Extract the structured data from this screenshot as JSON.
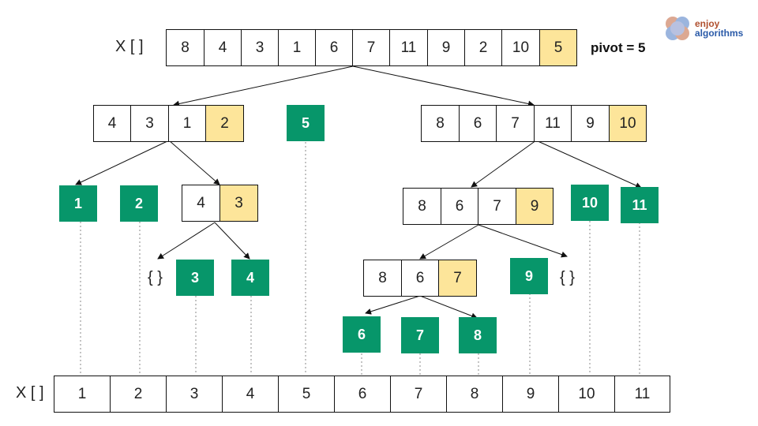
{
  "title_label": "X [ ]",
  "pivot_text": "pivot = 5",
  "logo": {
    "line1": "enjoy",
    "line2": "algorithms"
  },
  "colors": {
    "sorted": "#07966a",
    "pivot": "#fde59a",
    "cell": "#ffffff"
  },
  "input_array": [
    "8",
    "4",
    "3",
    "1",
    "6",
    "7",
    "11",
    "9",
    "2",
    "10",
    "5"
  ],
  "level1_left": [
    "4",
    "3",
    "1",
    "2"
  ],
  "level1_pivot": "5",
  "level1_right": [
    "8",
    "6",
    "7",
    "11",
    "9",
    "10"
  ],
  "level2_left_sorted": [
    "1",
    "2"
  ],
  "level2_mid": [
    "4",
    "3"
  ],
  "level2_right": [
    "8",
    "6",
    "7",
    "9"
  ],
  "level2_right_sorted": [
    "10",
    "11"
  ],
  "level3_empty_left": "{ }",
  "level3_sorted_left": [
    "3",
    "4"
  ],
  "level3_mid": [
    "8",
    "6",
    "7"
  ],
  "level3_sorted_right": "9",
  "level3_empty_right": "{ }",
  "level4_sorted": [
    "6",
    "7",
    "8"
  ],
  "output_label": "X [ ]",
  "output_array": [
    "1",
    "2",
    "3",
    "4",
    "5",
    "6",
    "7",
    "8",
    "9",
    "10",
    "11"
  ]
}
